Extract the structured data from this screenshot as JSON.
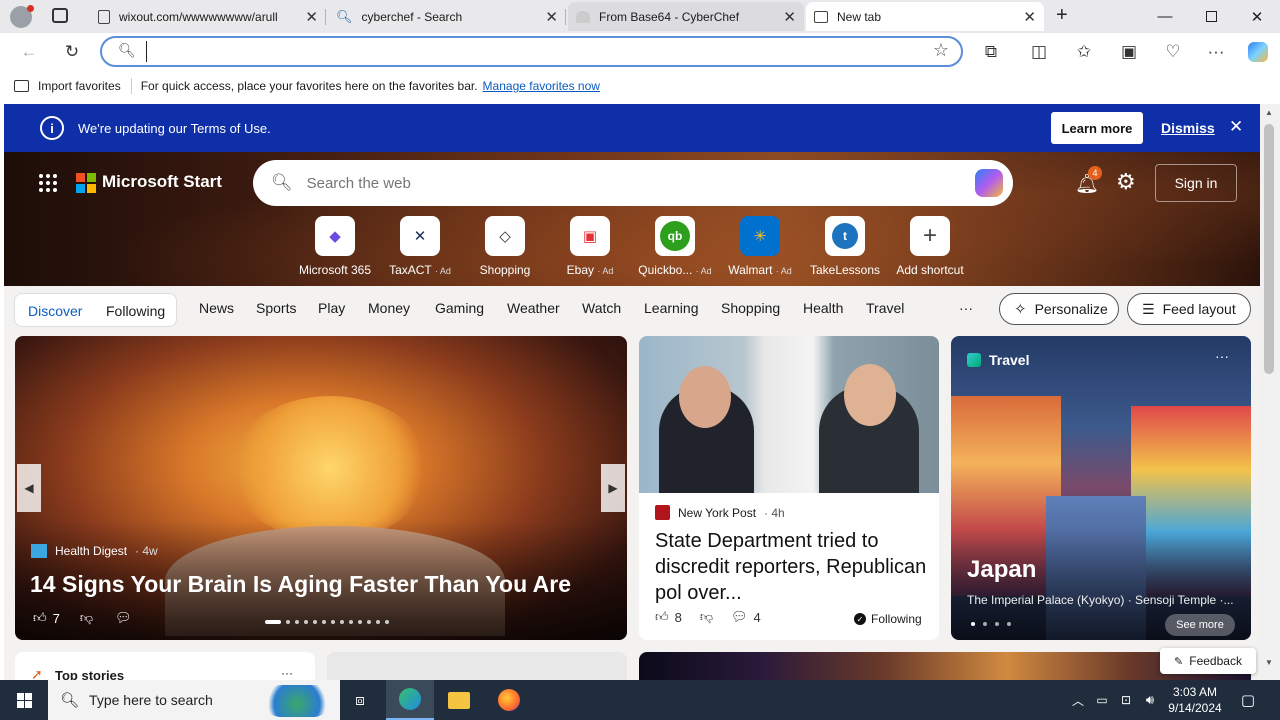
{
  "tabs": [
    {
      "title": "wixout.com/wwwwwwww/arull",
      "icon": "page-icon"
    },
    {
      "title": "cyberchef - Search",
      "icon": "search-icon"
    },
    {
      "title": "From Base64 - CyberChef",
      "icon": "chef-hat-icon"
    },
    {
      "title": "New tab",
      "icon": "newtab-icon"
    }
  ],
  "address": {
    "value": "",
    "placeholder": ""
  },
  "favbar": {
    "import_label": "Import favorites",
    "hint": "For quick access, place your favorites here on the favorites bar.",
    "manage_link": "Manage favorites now"
  },
  "banner": {
    "text": "We're updating our Terms of Use.",
    "learn_more": "Learn more",
    "dismiss": "Dismiss"
  },
  "header": {
    "brand": "Microsoft Start",
    "search_placeholder": "Search the web",
    "notif_count": "4",
    "sign_in": "Sign in"
  },
  "shortcuts": [
    {
      "label": "Microsoft 365",
      "ad": "",
      "glyph": "◆",
      "color": "#6a4ce0"
    },
    {
      "label": "TaxACT",
      "ad": "· Ad",
      "glyph": "✕",
      "color": "#1a2c5b"
    },
    {
      "label": "Shopping",
      "ad": "",
      "glyph": "◇",
      "color": "#333333"
    },
    {
      "label": "Ebay",
      "ad": "· Ad",
      "glyph": "▣",
      "color": "#e53238"
    },
    {
      "label": "Quickbo...",
      "ad": "· Ad",
      "glyph": "qb",
      "color": "#2ca01c"
    },
    {
      "label": "Walmart",
      "ad": "· Ad",
      "glyph": "✳",
      "color": "#0071ce"
    },
    {
      "label": "TakeLessons",
      "ad": "",
      "glyph": "t",
      "color": "#1e73be"
    },
    {
      "label": "Add shortcut",
      "ad": "",
      "glyph": "+",
      "color": "#444444"
    }
  ],
  "nav": {
    "discover": "Discover",
    "following": "Following",
    "items": [
      "News",
      "Sports",
      "Play",
      "Money",
      "Gaming",
      "Weather",
      "Watch",
      "Learning",
      "Shopping",
      "Health",
      "Travel"
    ],
    "more": "···",
    "personalize": "Personalize",
    "feed_layout": "Feed layout"
  },
  "main_card": {
    "source": "Health Digest",
    "age": "· 4w",
    "headline": "14 Signs Your Brain Is Aging Faster Than You Are",
    "likes": "7"
  },
  "news_card": {
    "source": "New York Post",
    "age": "· 4h",
    "headline": "State Department tried to discredit reporters, Republican pol over...",
    "likes": "8",
    "comments": "4",
    "following": "Following"
  },
  "travel_card": {
    "tag": "Travel",
    "title": "Japan",
    "subtitle": "The Imperial Palace (Kyokyo) · Sensoji Temple ·...",
    "see_more": "See more"
  },
  "bottom": {
    "top_stories": "Top stories",
    "feedback": "Feedback"
  },
  "taskbar": {
    "search_placeholder": "Type here to search",
    "time": "3:03 AM",
    "date": "9/14/2024"
  }
}
